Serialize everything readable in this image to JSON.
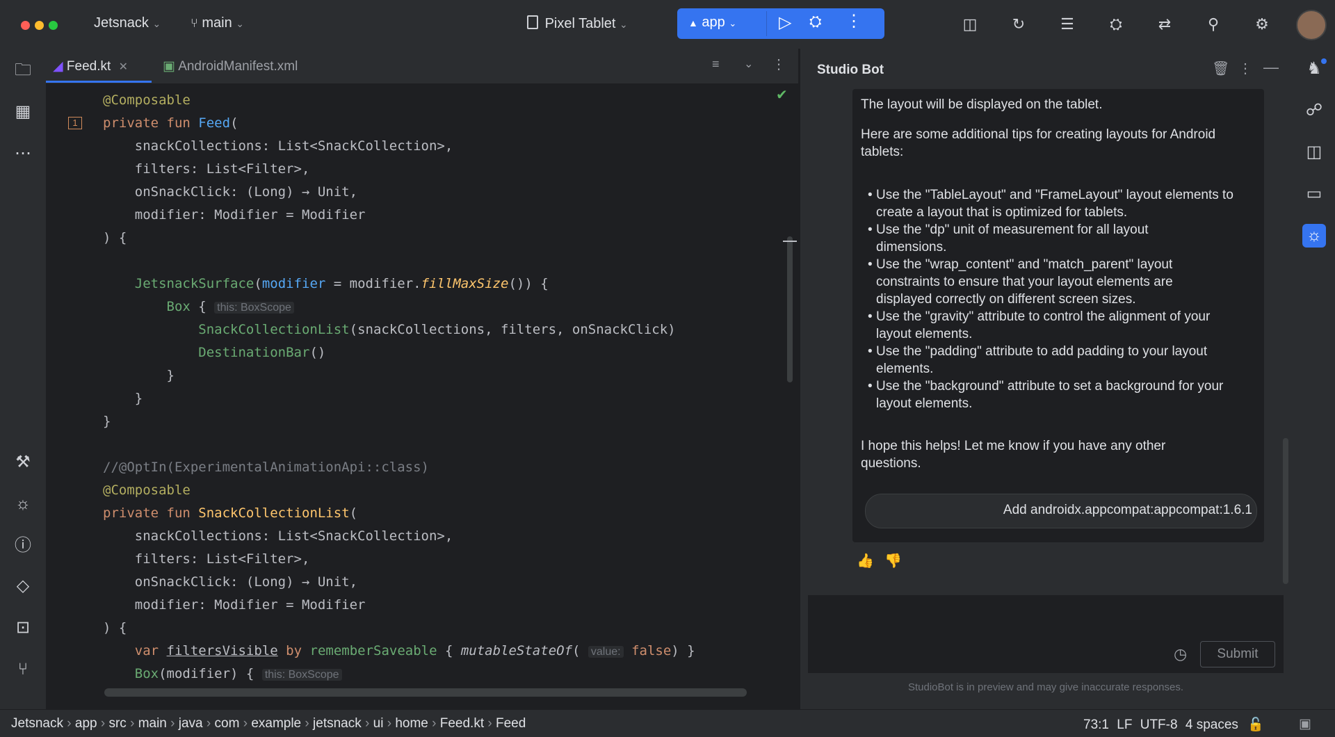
{
  "titlebar": {
    "project": "Jetsnack",
    "branch": "main",
    "device": "Pixel Tablet",
    "run_config": "app"
  },
  "editor": {
    "tabs": [
      {
        "label": "Feed.kt",
        "active": true
      },
      {
        "label": "AndroidManifest.xml",
        "active": false
      }
    ],
    "lines": [
      {
        "html": "<span class='ann'>@Composable</span>"
      },
      {
        "html": "<span class='kw'>private fun</span> <span class='fn'>Feed</span>("
      },
      {
        "html": "    snackCollections: List&lt;SnackCollection&gt;,"
      },
      {
        "html": "    filters: List&lt;Filter&gt;,"
      },
      {
        "html": "    onSnackClick: (Long) → Unit,"
      },
      {
        "html": "    modifier: Modifier = Modifier"
      },
      {
        "html": ") {"
      },
      {
        "html": ""
      },
      {
        "html": "    <span class='grn'>JetsnackSurface</span>(<span class='fn'>modifier</span> = modifier.<span class='yel it'>fillMaxSize</span>()) {"
      },
      {
        "html": "        <span class='grn'>Box</span> { <span class='hint'>this: BoxScope</span>"
      },
      {
        "html": "            <span class='grn'>SnackCollectionList</span>(snackCollections, filters, onSnackClick)"
      },
      {
        "html": "            <span class='grn'>DestinationBar</span>()"
      },
      {
        "html": "        }"
      },
      {
        "html": "    }"
      },
      {
        "html": "}"
      },
      {
        "html": ""
      },
      {
        "html": "<span class='cmt'>//@OptIn(ExperimentalAnimationApi::class)</span>"
      },
      {
        "html": "<span class='ann'>@Composable</span>"
      },
      {
        "html": "<span class='kw'>private fun</span> <span class='yel'>SnackCollectionList</span>("
      },
      {
        "html": "    snackCollections: List&lt;SnackCollection&gt;,"
      },
      {
        "html": "    filters: List&lt;Filter&gt;,"
      },
      {
        "html": "    onSnackClick: (Long) → Unit,"
      },
      {
        "html": "    modifier: Modifier = Modifier"
      },
      {
        "html": ") {"
      },
      {
        "html": "    <span class='kw'>var</span> <u>filtersVisible</u> <span class='kw'>by</span> <span class='grn'>rememberSaveable</span> { <span class='it'>mutableStateOf</span>( <span class='hint'>value:</span> <span class='kw'>false</span>) }"
      },
      {
        "html": "    <span class='grn'>Box</span>(modifier) { <span class='hint'>this: BoxScope</span>"
      }
    ]
  },
  "studio_bot": {
    "title": "Studio Bot",
    "intro": "The layout will be displayed on the tablet.",
    "tips_heading": "Here are some additional tips for creating layouts for Android tablets:",
    "tips": [
      "Use the \"TableLayout\" and \"FrameLayout\" layout elements to create a layout that is optimized for tablets.",
      "Use the \"dp\" unit of measurement for all layout dimensions.",
      "Use the \"wrap_content\" and \"match_parent\" layout constraints to ensure that your layout elements are displayed correctly on different screen sizes.",
      "Use the \"gravity\" attribute to control the alignment of your layout elements.",
      "Use the \"padding\" attribute to add padding to your layout elements.",
      "Use the \"background\" attribute to set a background for your layout elements."
    ],
    "closing": "I hope this helps! Let me know if you have any other questions.",
    "action_button": "Add androidx.appcompat:appcompat:1.6.1",
    "submit_label": "Submit",
    "disclaimer": "StudioBot is in preview and may give inaccurate responses."
  },
  "statusbar": {
    "breadcrumbs": [
      "Jetsnack",
      "app",
      "src",
      "main",
      "java",
      "com",
      "example",
      "jetsnack",
      "ui",
      "home",
      "Feed.kt",
      "Feed"
    ],
    "position": "73:1",
    "line_sep": "LF",
    "encoding": "UTF-8",
    "indent": "4 spaces"
  },
  "colors": {
    "accent": "#3574f0",
    "bg": "#1e1f22",
    "panel": "#2b2d30"
  }
}
